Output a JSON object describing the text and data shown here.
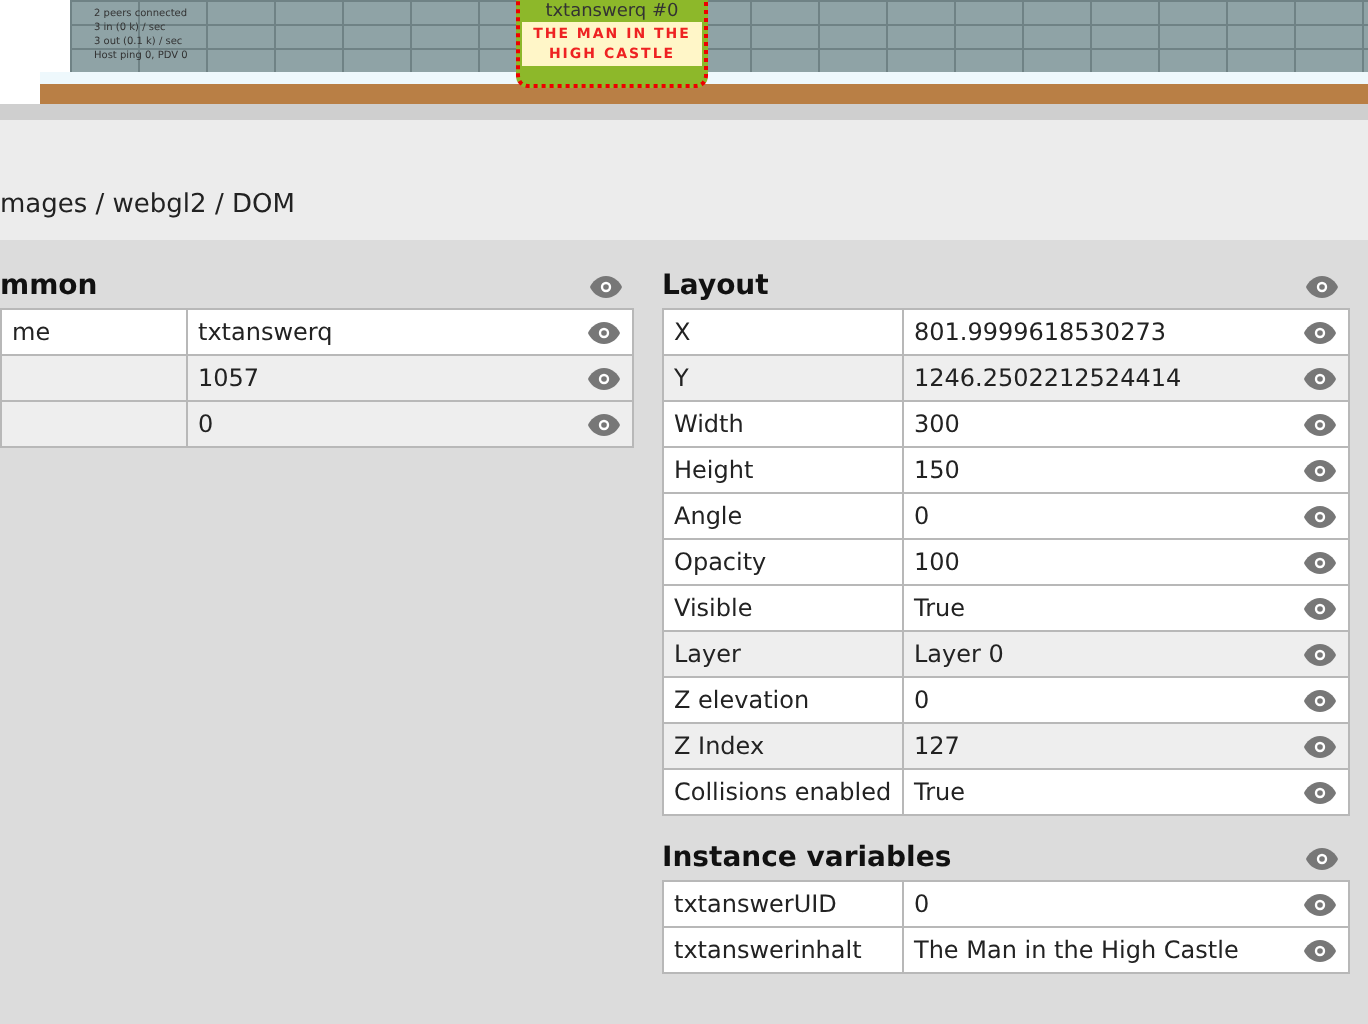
{
  "game_view": {
    "stats": [
      "2 peers connected",
      "3 in (0 k) / sec",
      "3 out (0.1 k) / sec",
      "Host ping 0, PDV 0"
    ],
    "object_label": "txtanswerq #0",
    "sign_text": "THE MAN IN THE HIGH CASTLE"
  },
  "breadcrumb": "mages / webgl2 / DOM",
  "sections": [
    {
      "title": "mmon",
      "rows": [
        {
          "label": "me",
          "value": "txtanswerq",
          "readonly": false
        },
        {
          "value": "1057",
          "readonly": true
        },
        {
          "value": "0",
          "readonly": true
        }
      ]
    },
    {
      "title": "Layout",
      "rows": [
        {
          "label": "X",
          "value": "801.9999618530273",
          "readonly": false
        },
        {
          "label": "Y",
          "value": "1246.2502212524414",
          "readonly": true
        },
        {
          "label": "Width",
          "value": "300",
          "readonly": false
        },
        {
          "label": "Height",
          "value": "150",
          "readonly": false
        },
        {
          "label": "Angle",
          "value": "0",
          "readonly": false
        },
        {
          "label": "Opacity",
          "value": "100",
          "readonly": false
        },
        {
          "label": "Visible",
          "value": "True",
          "readonly": false
        },
        {
          "label": "Layer",
          "value": "Layer 0",
          "readonly": true
        },
        {
          "label": "Z elevation",
          "value": "0",
          "readonly": false
        },
        {
          "label": "Z Index",
          "value": "127",
          "readonly": true
        },
        {
          "label": "Collisions enabled",
          "value": "True",
          "readonly": false
        }
      ]
    },
    {
      "title": "Instance variables",
      "rows": [
        {
          "label": "txtanswerUID",
          "value": "0",
          "readonly": false
        },
        {
          "label": "txtanswerinhalt",
          "value": "The Man in the High Castle",
          "readonly": false
        }
      ]
    }
  ]
}
